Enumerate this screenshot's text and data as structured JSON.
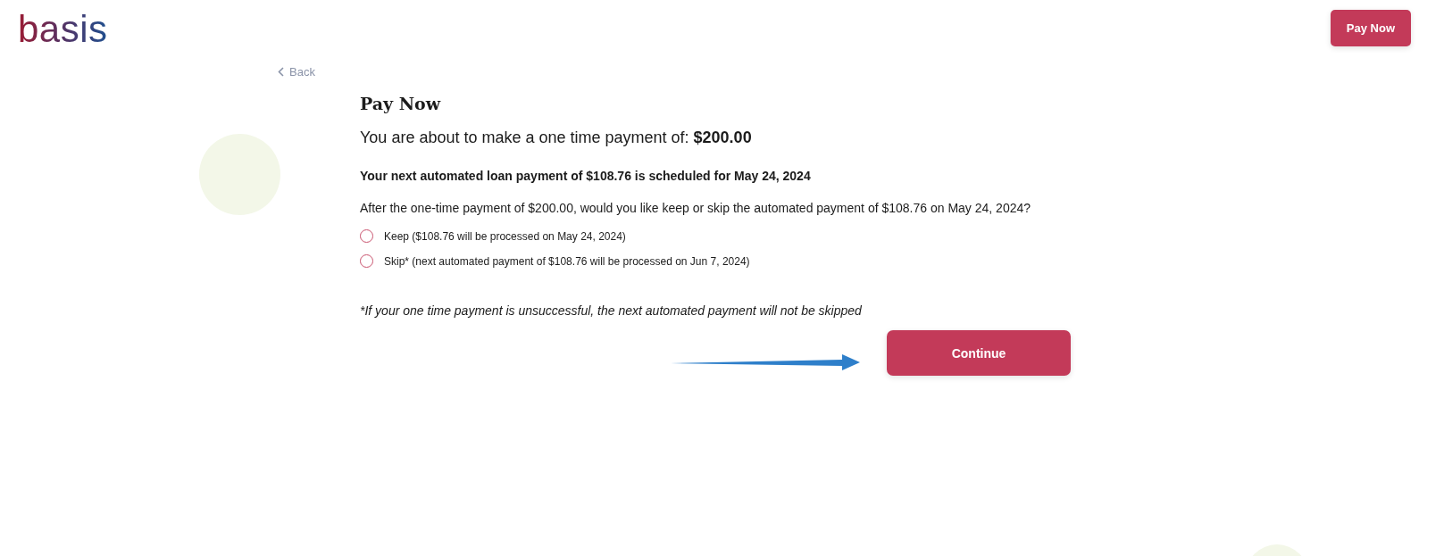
{
  "header": {
    "logo": "basis",
    "pay_now_button": "Pay Now"
  },
  "back_link": "Back",
  "title": "Pay Now",
  "payment_line": "You are about to make a one time payment of: **$200.00**",
  "schedule_notice": "Your next automated loan payment of $108.76 is scheduled for May 24, 2024",
  "question": "After the one-time payment of $200.00, would you like keep or skip the automated payment of $108.76 on May 24, 2024?",
  "options": [
    {
      "label": "Keep ($108.76 will be processed on May 24, 2024)",
      "selected": false
    },
    {
      "label": "Skip* (next automated payment of $108.76 will be processed on Jun 7, 2024)",
      "selected": false
    }
  ],
  "footnote": "*If your one time payment is unsuccessful, the next automated payment will not be skipped",
  "continue_button": "Continue"
}
